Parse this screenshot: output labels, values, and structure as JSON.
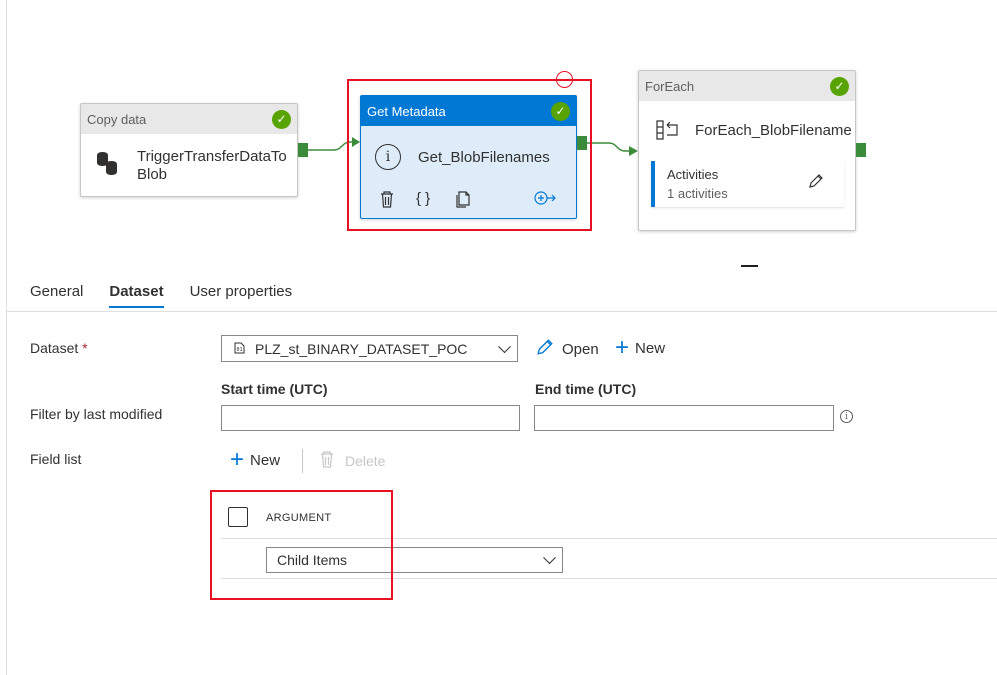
{
  "pipeline": {
    "copy_node": {
      "header": "Copy data",
      "title": "TriggerTransferDataTo Blob"
    },
    "meta_node": {
      "header": "Get Metadata",
      "title": "Get_BlobFilenames"
    },
    "foreach_node": {
      "header": "ForEach",
      "title": "ForEach_BlobFilename",
      "activities_label": "Activities",
      "activities_count": "1 activities"
    }
  },
  "tabs": [
    {
      "label": "General",
      "active": false
    },
    {
      "label": "Dataset",
      "active": true
    },
    {
      "label": "User properties",
      "active": false
    }
  ],
  "form": {
    "dataset_label": "Dataset",
    "required_mark": "*",
    "dataset_value": "PLZ_st_BINARY_DATASET_POC",
    "open_label": "Open",
    "new_label": "New",
    "filter_label": "Filter by last modified",
    "start_time_label": "Start time (UTC)",
    "end_time_label": "End time (UTC)",
    "start_time_value": "",
    "end_time_value": "",
    "field_list_label": "Field list",
    "field_new_label": "New",
    "field_delete_label": "Delete",
    "argument_header": "ARGUMENT",
    "argument_value": "Child Items"
  },
  "colors": {
    "accent": "#0078d4",
    "success": "#57a300",
    "highlight": "#e81123",
    "port": "#3a8c3a"
  }
}
